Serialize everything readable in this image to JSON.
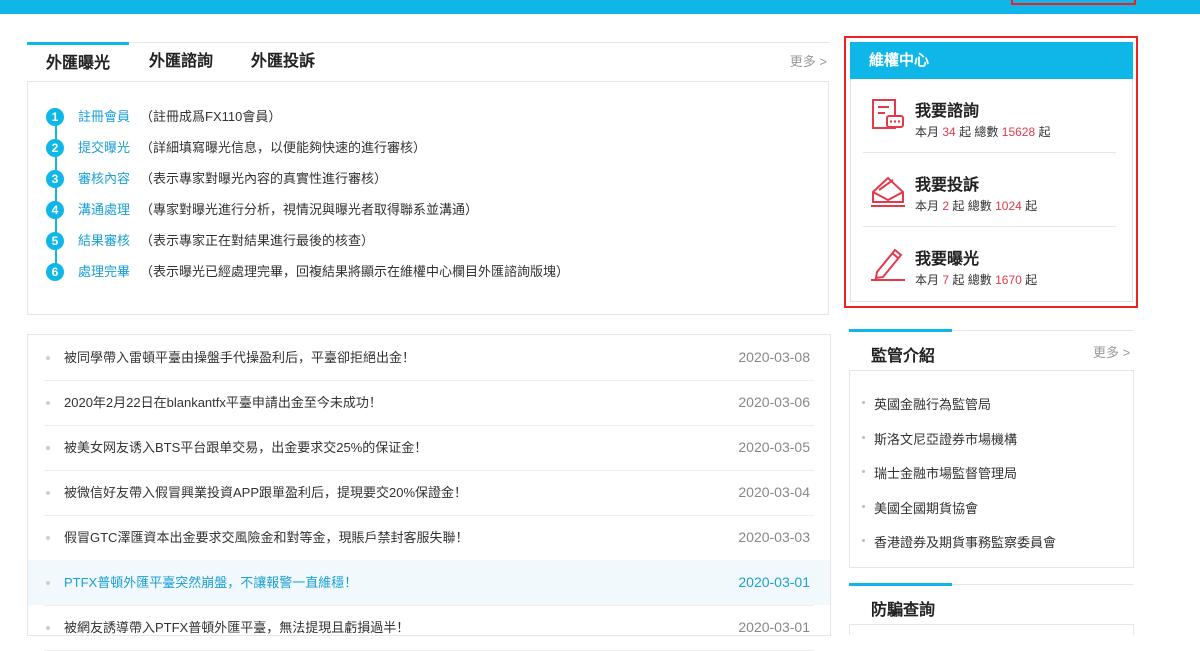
{
  "exposure": {
    "tabs": [
      "外匯曝光",
      "外匯諮詢",
      "外匯投訴"
    ],
    "active_tab": "外匯曝光",
    "more": "更多 >",
    "steps": [
      {
        "num": "1",
        "label": "註冊會員",
        "desc": "（註冊成爲FX110會員）"
      },
      {
        "num": "2",
        "label": "提交曝光",
        "desc": "（詳細填寫曝光信息，以便能夠快速的進行審核）"
      },
      {
        "num": "3",
        "label": "審核內容",
        "desc": "（表示專家對曝光內容的真實性進行審核）"
      },
      {
        "num": "4",
        "label": "溝通處理",
        "desc": "（專家對曝光進行分析，視情況與曝光者取得聯系並溝通）"
      },
      {
        "num": "5",
        "label": "結果審核",
        "desc": "（表示專家正在對結果進行最後的核查）"
      },
      {
        "num": "6",
        "label": "處理完畢",
        "desc": "（表示曝光已經處理完畢，回複結果將顯示在維權中心欄目外匯諮詢版塊）"
      }
    ]
  },
  "news": [
    {
      "title": "被同學帶入雷頓平臺由操盤手代操盈利后，平臺卻拒絕出金！",
      "date": "2020-03-08"
    },
    {
      "title": "2020年2月22日在blankantfx平臺申請出金至今未成功！",
      "date": "2020-03-06"
    },
    {
      "title": "被美女网友诱入BTS平台跟单交易，出金要求交25%的保证金！",
      "date": "2020-03-05"
    },
    {
      "title": "被微信好友帶入假冒興業投資APP跟單盈利后，提現要交20%保證金！",
      "date": "2020-03-04"
    },
    {
      "title": "假冒GTC澤匯資本出金要求交風險金和對等金，現賬戶禁封客服失聯！",
      "date": "2020-03-03"
    },
    {
      "title": "PTFX普頓外匯平臺突然崩盤，不讓報警一直維穩！",
      "date": "2020-03-01",
      "highlight": true
    },
    {
      "title": "被網友誘導帶入PTFX普頓外匯平臺，無法提現且虧損過半！",
      "date": "2020-03-01"
    }
  ],
  "rights": {
    "title": "維權中心",
    "items": [
      {
        "title": "我要諮詢",
        "month_label": "本月",
        "month": "34",
        "unit1": "起",
        "total_label": "總數",
        "total": "15628",
        "unit2": "起",
        "icon": "consult-form-icon"
      },
      {
        "title": "我要投訴",
        "month_label": "本月",
        "month": "2",
        "unit1": "起",
        "total_label": "總數",
        "total": "1024",
        "unit2": "起",
        "icon": "complaint-envelope-icon"
      },
      {
        "title": "我要曝光",
        "month_label": "本月",
        "month": "7",
        "unit1": "起",
        "total_label": "總數",
        "total": "1670",
        "unit2": "起",
        "icon": "pencil-icon"
      }
    ],
    "accent": "#e23a4a"
  },
  "regulators": {
    "title": "監管介紹",
    "more": "更多 >",
    "items": [
      "英國金融行為監管局",
      "斯洛文尼亞證券市場機構",
      "瑞士金融市場監督管理局",
      "美國全國期貨協會",
      "香港證券及期貨事務監察委員會"
    ]
  },
  "anti_fraud": {
    "title": "防騙查詢"
  },
  "colors": {
    "brand_blue": "#0fb6e8",
    "link_blue": "#1a9fd6",
    "highlight_red": "#e22"
  }
}
